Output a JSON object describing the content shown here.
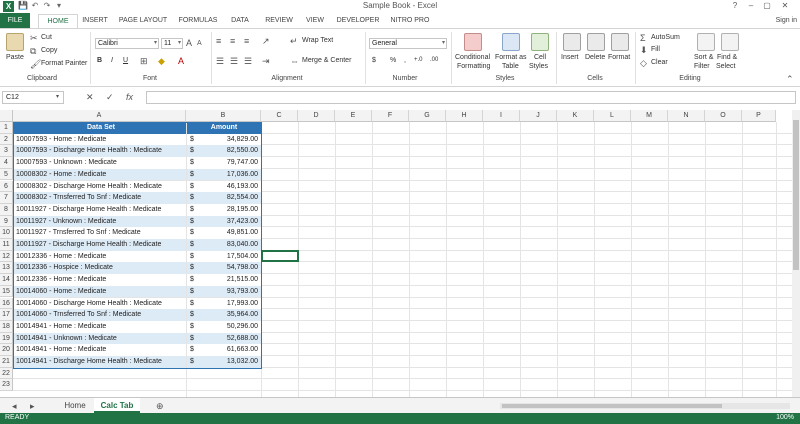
{
  "window": {
    "title": "Sample Book - Excel",
    "signin": "Sign in"
  },
  "qat": {
    "save": "💾",
    "undo": "↶",
    "redo": "↷",
    "more": "▾"
  },
  "tabs": [
    "FILE",
    "HOME",
    "INSERT",
    "PAGE LAYOUT",
    "FORMULAS",
    "DATA",
    "REVIEW",
    "VIEW",
    "DEVELOPER",
    "NITRO PRO"
  ],
  "ribbon": {
    "clipboard": {
      "label": "Clipboard",
      "paste": "Paste",
      "cut": "Cut",
      "copy": "Copy",
      "format_painter": "Format Painter"
    },
    "font": {
      "label": "Font",
      "name": "Calibri",
      "size": "11",
      "bold": "B",
      "italic": "I",
      "underline": "U"
    },
    "alignment": {
      "label": "Alignment",
      "wrap": "Wrap Text",
      "merge": "Merge & Center"
    },
    "number": {
      "label": "Number",
      "format": "General",
      "currency": "$",
      "percent": "%",
      "comma": ",",
      "inc": "+.0",
      "dec": ".00"
    },
    "styles": {
      "label": "Styles",
      "conditional": "Conditional",
      "conditional2": "Formatting",
      "format_as": "Format as",
      "format_as2": "Table",
      "cell": "Cell",
      "cell2": "Styles"
    },
    "cells": {
      "label": "Cells",
      "insert": "Insert",
      "delete": "Delete",
      "format": "Format"
    },
    "editing": {
      "label": "Editing",
      "autosum": "AutoSum",
      "fill": "Fill",
      "clear": "Clear",
      "sort": "Sort &",
      "sort2": "Filter",
      "find": "Find &",
      "find2": "Select"
    }
  },
  "formula_bar": {
    "name_box": "C12",
    "fx": "fx",
    "cancel": "✕",
    "enter": "✓",
    "value": ""
  },
  "columns": [
    "A",
    "B",
    "C",
    "D",
    "E",
    "F",
    "G",
    "H",
    "I",
    "J",
    "K",
    "L",
    "M",
    "N",
    "O",
    "P"
  ],
  "table": {
    "header": {
      "a": "Data Set",
      "b": "Amount"
    },
    "rows": [
      {
        "a": "10007593 - Home : Medicate",
        "b": "34,829.00"
      },
      {
        "a": "10007593 - Discharge Home Health : Medicate",
        "b": "82,550.00"
      },
      {
        "a": "10007593 - Unknown : Medicate",
        "b": "79,747.00"
      },
      {
        "a": "10008302 - Home : Medicate",
        "b": "17,036.00"
      },
      {
        "a": "10008302 - Discharge Home Health : Medicate",
        "b": "46,193.00"
      },
      {
        "a": "10008302 - Trnsferred To Snf : Medicate",
        "b": "82,554.00"
      },
      {
        "a": "10011927 - Discharge Home Health : Medicate",
        "b": "28,195.00"
      },
      {
        "a": "10011927 - Unknown : Medicate",
        "b": "37,423.00"
      },
      {
        "a": "10011927 - Trnsferred To Snf : Medicate",
        "b": "49,851.00"
      },
      {
        "a": "10011927 - Discharge Home Health : Medicate",
        "b": "83,040.00"
      },
      {
        "a": "10012336 - Home : Medicate",
        "b": "17,504.00"
      },
      {
        "a": "10012336 - Hospice : Medicate",
        "b": "54,798.00"
      },
      {
        "a": "10012336 - Home : Medicate",
        "b": "21,515.00"
      },
      {
        "a": "10014060 - Home : Medicate",
        "b": "93,793.00"
      },
      {
        "a": "10014060 - Discharge Home Health : Medicate",
        "b": "17,993.00"
      },
      {
        "a": "10014060 - Trnsferred To Snf : Medicate",
        "b": "35,964.00"
      },
      {
        "a": "10014941 - Home : Medicate",
        "b": "50,296.00"
      },
      {
        "a": "10014941 - Unknown : Medicate",
        "b": "52,688.00"
      },
      {
        "a": "10014941 - Home : Medicate",
        "b": "61,663.00"
      },
      {
        "a": "10014941 - Discharge Home Health : Medicate",
        "b": "13,032.00"
      }
    ],
    "currency": "$"
  },
  "row_numbers": [
    "1",
    "2",
    "3",
    "4",
    "5",
    "6",
    "7",
    "8",
    "9",
    "10",
    "11",
    "12",
    "13",
    "14",
    "15",
    "16",
    "17",
    "18",
    "19",
    "20",
    "21",
    "22",
    "23"
  ],
  "sheets": {
    "tabs": [
      "Home",
      "Calc Tab"
    ],
    "active": "Calc Tab",
    "add": "⊕"
  },
  "status": {
    "mode": "READY",
    "zoom": "100%"
  }
}
